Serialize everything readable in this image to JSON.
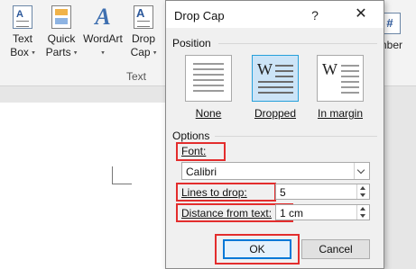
{
  "ribbon": {
    "buttons": [
      {
        "line1": "Text",
        "line2": "Box",
        "icon": "text-box-icon"
      },
      {
        "line1": "Quick",
        "line2": "Parts",
        "icon": "quick-parts-icon"
      },
      {
        "line1": "WordArt",
        "line2": "",
        "icon": "wordart-icon"
      },
      {
        "line1": "Drop",
        "line2": "Cap",
        "icon": "drop-cap-icon"
      }
    ],
    "group_label": "Text",
    "number_label": "umber",
    "number_icon_glyph": "#",
    "dropdown_glyph": "▾"
  },
  "dialog": {
    "title": "Drop Cap",
    "help_glyph": "?",
    "close_glyph": "✕",
    "position": {
      "label": "Position",
      "options": [
        {
          "label": "None",
          "selected": false,
          "glyph": ""
        },
        {
          "label": "Dropped",
          "selected": true,
          "glyph": "W"
        },
        {
          "label": "In margin",
          "selected": false,
          "glyph": "W"
        }
      ]
    },
    "options": {
      "label": "Options",
      "font_label": "Font:",
      "font_value": "Calibri",
      "lines_label": "Lines to drop:",
      "lines_value": "5",
      "distance_label": "Distance from text:",
      "distance_value": "1 cm"
    },
    "ok_label": "OK",
    "cancel_label": "Cancel"
  },
  "colors": {
    "highlight": "#e32d2d",
    "selected_fill": "#cce4f7",
    "accent": "#0078d7"
  }
}
